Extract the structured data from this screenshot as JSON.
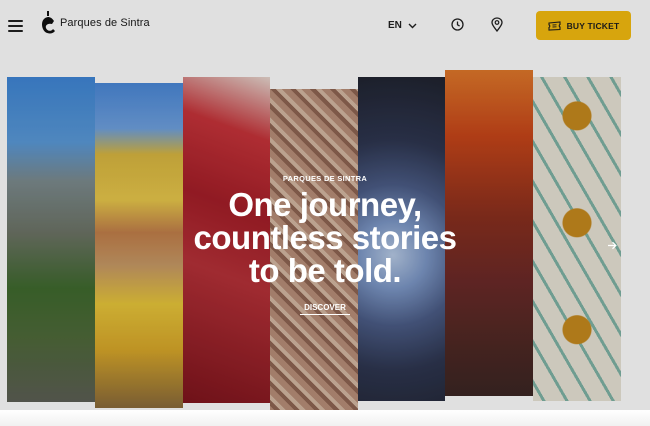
{
  "header": {
    "logo_text": "Parques de Sintra",
    "language": "EN",
    "ticket_button_label": "BUY TICKET"
  },
  "hero": {
    "eyebrow": "PARQUES DE SINTRA",
    "headline_lines": [
      "One journey,",
      "countless stories",
      "to be told."
    ],
    "cta_label": "DISCOVER"
  },
  "colors": {
    "accent": "#f5bc0f",
    "text_dark": "#1a1a1a",
    "hero_text": "#ffffff"
  },
  "icons": {
    "menu": "hamburger-icon",
    "language_toggle": "chevron-down-icon",
    "opening_hours": "clock-icon",
    "location": "map-pin-icon",
    "ticket": "ticket-icon",
    "next": "arrow-right-icon"
  }
}
